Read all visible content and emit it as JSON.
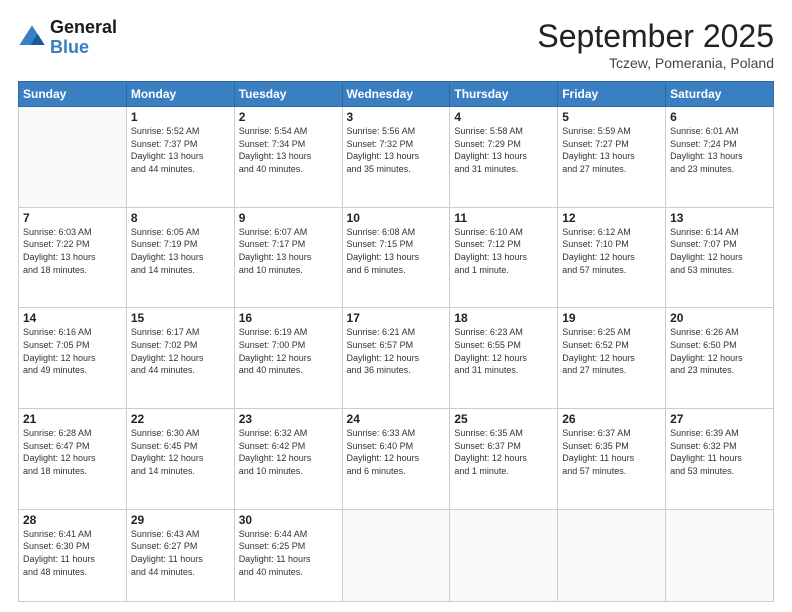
{
  "header": {
    "logo_line1": "General",
    "logo_line2": "Blue",
    "month": "September 2025",
    "location": "Tczew, Pomerania, Poland"
  },
  "weekdays": [
    "Sunday",
    "Monday",
    "Tuesday",
    "Wednesday",
    "Thursday",
    "Friday",
    "Saturday"
  ],
  "weeks": [
    [
      {
        "day": "",
        "info": ""
      },
      {
        "day": "1",
        "info": "Sunrise: 5:52 AM\nSunset: 7:37 PM\nDaylight: 13 hours\nand 44 minutes."
      },
      {
        "day": "2",
        "info": "Sunrise: 5:54 AM\nSunset: 7:34 PM\nDaylight: 13 hours\nand 40 minutes."
      },
      {
        "day": "3",
        "info": "Sunrise: 5:56 AM\nSunset: 7:32 PM\nDaylight: 13 hours\nand 35 minutes."
      },
      {
        "day": "4",
        "info": "Sunrise: 5:58 AM\nSunset: 7:29 PM\nDaylight: 13 hours\nand 31 minutes."
      },
      {
        "day": "5",
        "info": "Sunrise: 5:59 AM\nSunset: 7:27 PM\nDaylight: 13 hours\nand 27 minutes."
      },
      {
        "day": "6",
        "info": "Sunrise: 6:01 AM\nSunset: 7:24 PM\nDaylight: 13 hours\nand 23 minutes."
      }
    ],
    [
      {
        "day": "7",
        "info": "Sunrise: 6:03 AM\nSunset: 7:22 PM\nDaylight: 13 hours\nand 18 minutes."
      },
      {
        "day": "8",
        "info": "Sunrise: 6:05 AM\nSunset: 7:19 PM\nDaylight: 13 hours\nand 14 minutes."
      },
      {
        "day": "9",
        "info": "Sunrise: 6:07 AM\nSunset: 7:17 PM\nDaylight: 13 hours\nand 10 minutes."
      },
      {
        "day": "10",
        "info": "Sunrise: 6:08 AM\nSunset: 7:15 PM\nDaylight: 13 hours\nand 6 minutes."
      },
      {
        "day": "11",
        "info": "Sunrise: 6:10 AM\nSunset: 7:12 PM\nDaylight: 13 hours\nand 1 minute."
      },
      {
        "day": "12",
        "info": "Sunrise: 6:12 AM\nSunset: 7:10 PM\nDaylight: 12 hours\nand 57 minutes."
      },
      {
        "day": "13",
        "info": "Sunrise: 6:14 AM\nSunset: 7:07 PM\nDaylight: 12 hours\nand 53 minutes."
      }
    ],
    [
      {
        "day": "14",
        "info": "Sunrise: 6:16 AM\nSunset: 7:05 PM\nDaylight: 12 hours\nand 49 minutes."
      },
      {
        "day": "15",
        "info": "Sunrise: 6:17 AM\nSunset: 7:02 PM\nDaylight: 12 hours\nand 44 minutes."
      },
      {
        "day": "16",
        "info": "Sunrise: 6:19 AM\nSunset: 7:00 PM\nDaylight: 12 hours\nand 40 minutes."
      },
      {
        "day": "17",
        "info": "Sunrise: 6:21 AM\nSunset: 6:57 PM\nDaylight: 12 hours\nand 36 minutes."
      },
      {
        "day": "18",
        "info": "Sunrise: 6:23 AM\nSunset: 6:55 PM\nDaylight: 12 hours\nand 31 minutes."
      },
      {
        "day": "19",
        "info": "Sunrise: 6:25 AM\nSunset: 6:52 PM\nDaylight: 12 hours\nand 27 minutes."
      },
      {
        "day": "20",
        "info": "Sunrise: 6:26 AM\nSunset: 6:50 PM\nDaylight: 12 hours\nand 23 minutes."
      }
    ],
    [
      {
        "day": "21",
        "info": "Sunrise: 6:28 AM\nSunset: 6:47 PM\nDaylight: 12 hours\nand 18 minutes."
      },
      {
        "day": "22",
        "info": "Sunrise: 6:30 AM\nSunset: 6:45 PM\nDaylight: 12 hours\nand 14 minutes."
      },
      {
        "day": "23",
        "info": "Sunrise: 6:32 AM\nSunset: 6:42 PM\nDaylight: 12 hours\nand 10 minutes."
      },
      {
        "day": "24",
        "info": "Sunrise: 6:33 AM\nSunset: 6:40 PM\nDaylight: 12 hours\nand 6 minutes."
      },
      {
        "day": "25",
        "info": "Sunrise: 6:35 AM\nSunset: 6:37 PM\nDaylight: 12 hours\nand 1 minute."
      },
      {
        "day": "26",
        "info": "Sunrise: 6:37 AM\nSunset: 6:35 PM\nDaylight: 11 hours\nand 57 minutes."
      },
      {
        "day": "27",
        "info": "Sunrise: 6:39 AM\nSunset: 6:32 PM\nDaylight: 11 hours\nand 53 minutes."
      }
    ],
    [
      {
        "day": "28",
        "info": "Sunrise: 6:41 AM\nSunset: 6:30 PM\nDaylight: 11 hours\nand 48 minutes."
      },
      {
        "day": "29",
        "info": "Sunrise: 6:43 AM\nSunset: 6:27 PM\nDaylight: 11 hours\nand 44 minutes."
      },
      {
        "day": "30",
        "info": "Sunrise: 6:44 AM\nSunset: 6:25 PM\nDaylight: 11 hours\nand 40 minutes."
      },
      {
        "day": "",
        "info": ""
      },
      {
        "day": "",
        "info": ""
      },
      {
        "day": "",
        "info": ""
      },
      {
        "day": "",
        "info": ""
      }
    ]
  ]
}
